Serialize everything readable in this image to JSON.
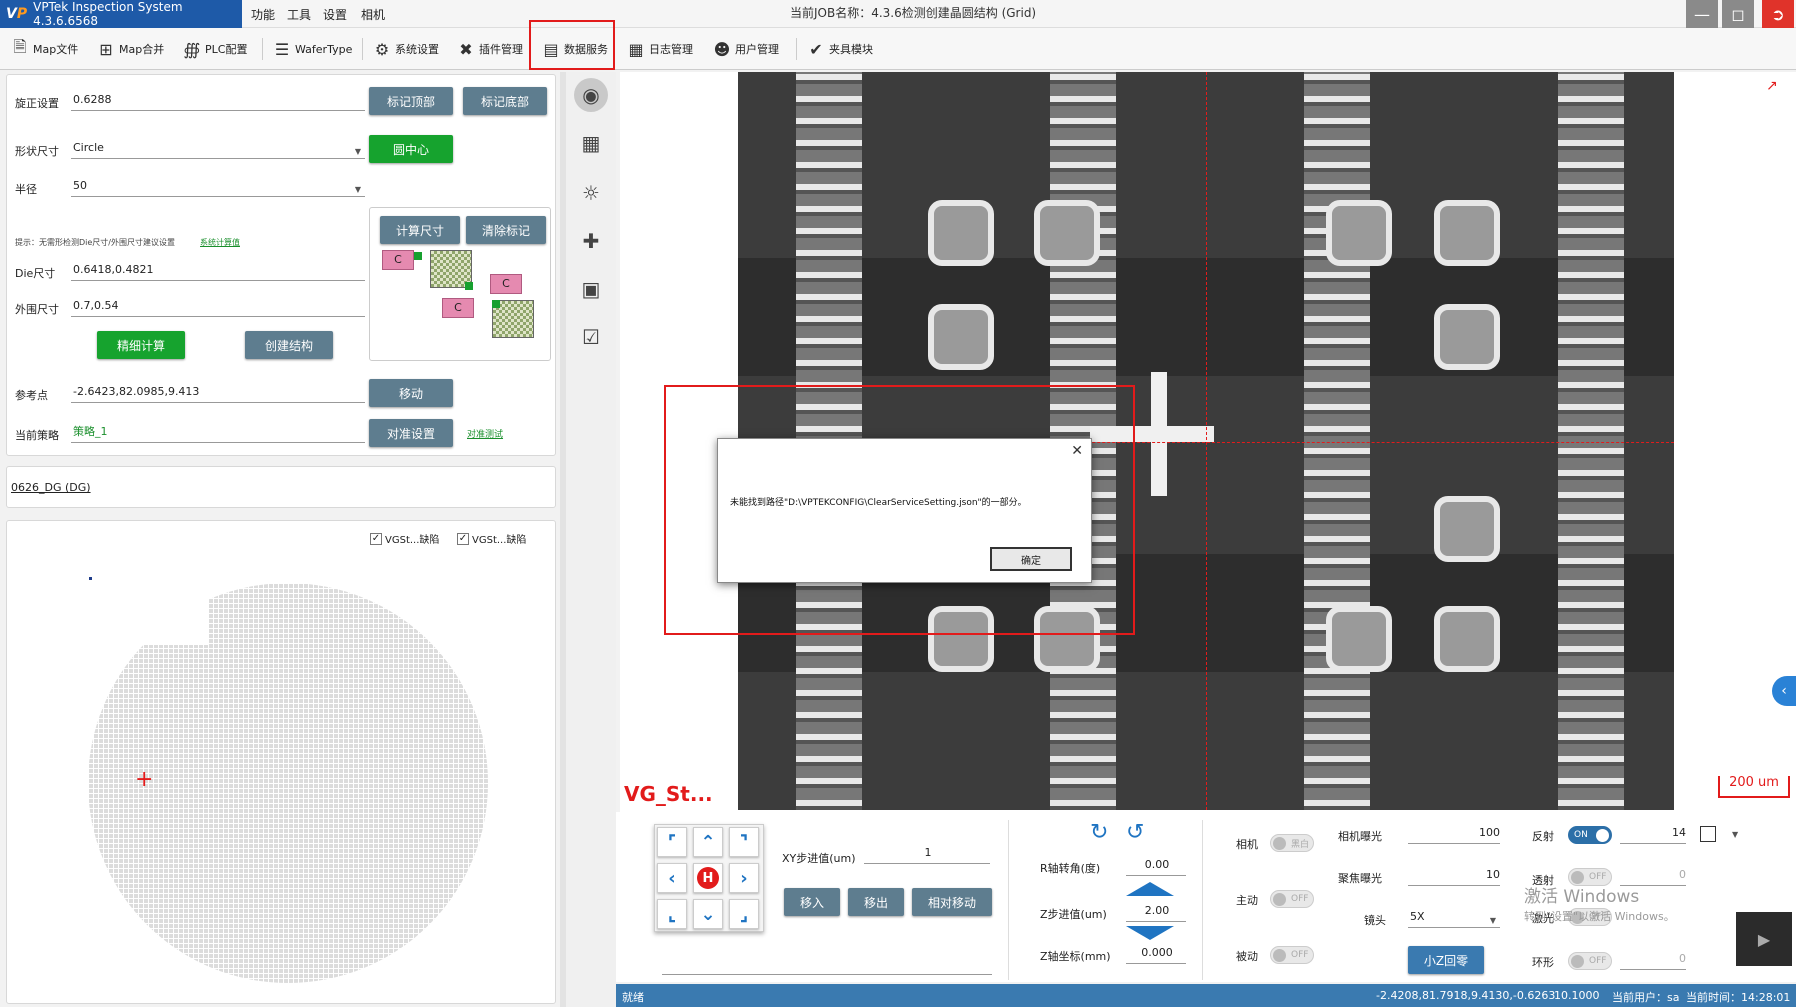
{
  "titlebar": {
    "app_name": "VPTek Inspection System 4.3.6.6568",
    "menu": [
      "功能",
      "工具",
      "设置",
      "相机"
    ],
    "job_title": "当前JOB名称：4.3.6检测创建晶圆结构 (Grid)"
  },
  "toolbar": {
    "items": [
      "Map文件",
      "Map合并",
      "PLC配置",
      "WaferType",
      "系统设置",
      "插件管理",
      "数据服务",
      "日志管理",
      "用户管理",
      "夹具模块"
    ]
  },
  "left": {
    "rotation_label": "旋正设置",
    "rotation_value": "0.6288",
    "mark_top": "标记顶部",
    "mark_bottom": "标记底部",
    "shape_label": "形状尺寸",
    "shape_value": "Circle",
    "circle_center": "圆中心",
    "radius_label": "半径",
    "radius_value": "50",
    "calc_size": "计算尺寸",
    "clear_mark": "清除标记",
    "hint": "提示：无需形检测Die尺寸/外围尺寸建议设置",
    "hint_link": "系统计算值",
    "die_label": "Die尺寸",
    "die_value": "0.6418,0.4821",
    "outer_label": "外围尺寸",
    "outer_value": "0.7,0.54",
    "fine_calc": "精细计算",
    "create_struct": "创建结构",
    "c_label": "C",
    "ref_label": "参考点",
    "ref_value": "-2.6423,82.0985,9.413",
    "move": "移动",
    "strategy_label": "当前策略",
    "strategy_value": "策略_1",
    "align_setting": "对准设置",
    "align_test": "对准测试",
    "recipe": "0626_DG (DG)",
    "check1": "VGSt...缺陷",
    "check2": "VGSt...缺陷"
  },
  "viewer": {
    "overlay_text": "VG_St...",
    "scale": "200 um"
  },
  "dialog": {
    "message": "未能找到路径\"D:\\VPTEKCONFIG\\ClearServiceSetting.json\"的一部分。",
    "ok": "确定"
  },
  "controls": {
    "xy_step_label": "XY步进值(um)",
    "xy_step_value": "1",
    "move_in": "移入",
    "move_out": "移出",
    "rel_move": "相对移动",
    "r_label": "R轴转角(度)",
    "r_value": "0.00",
    "z_step_label": "Z步进值(um)",
    "z_step_value": "2.00",
    "z_coord_label": "Z轴坐标(mm)",
    "z_coord_value": "0.000",
    "camera_label": "相机",
    "camera_toggle": "黑白",
    "active_label": "主动",
    "passive_label": "被动",
    "off": "OFF",
    "on": "ON",
    "exposure_label": "相机曝光",
    "exposure_value": "100",
    "focus_exposure_label": "聚焦曝光",
    "focus_exposure_value": "10",
    "lens_label": "镜头",
    "lens_value": "5X",
    "small_z": "小Z回零",
    "reflect_label": "反射",
    "reflect_value": "14",
    "transmit_label": "透射",
    "transmit_value": "0",
    "laser_label": "激光",
    "ring_label": "环形",
    "ring_value": "0",
    "home": "H",
    "watermark1": "激活 Windows",
    "watermark2": "转到\"设置\"以激活 Windows。"
  },
  "status": {
    "left": "就绪",
    "coords": "-2.4208,81.7918,9.4130,-0.6263",
    "zoom": "10.1000",
    "user": "当前用户：sa",
    "time": "当前时间：14:28:01"
  }
}
